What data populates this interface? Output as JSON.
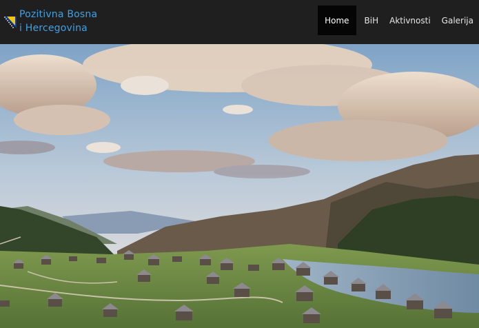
{
  "brand": {
    "text": "Pozitivna Bosna\ni Hercegovina",
    "logo_icon": "bih-flag-icon",
    "color": "#3fa2e6"
  },
  "nav": {
    "items": [
      {
        "label": "Home",
        "active": true
      },
      {
        "label": "BiH",
        "active": false
      },
      {
        "label": "Aktivnosti",
        "active": false
      },
      {
        "label": "Galerija",
        "active": false
      }
    ]
  },
  "colors": {
    "navbar": "#1f1f1f",
    "active_item": "#050505",
    "nav_text": "#e6e6e6"
  }
}
